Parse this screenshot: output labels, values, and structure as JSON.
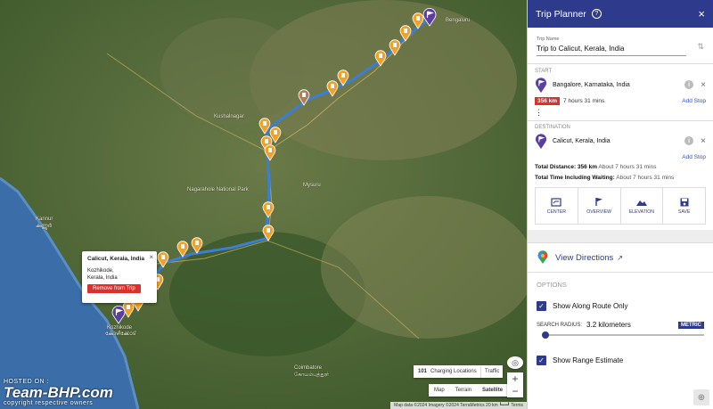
{
  "map": {
    "labels": [
      {
        "text": "Kozhikode"
      },
      {
        "text": "കോഴിക്കോട്"
      },
      {
        "text": "Coimbatore"
      },
      {
        "text": "கோயம்புத்தூர்"
      },
      {
        "text": "Kannur"
      },
      {
        "text": "കണ്ണൂർ"
      },
      {
        "text": "Kushalnagar"
      },
      {
        "text": "Nagarahole National Park"
      },
      {
        "text": "Mysuru"
      },
      {
        "text": "Bengaluru"
      }
    ],
    "popup": {
      "title": "Calicut, Kerala, India",
      "address_line1": "Kozhikode,",
      "address_line2": "Kerala, India",
      "remove_label": "Remove from Trip",
      "close_glyph": "×"
    },
    "charging": {
      "count": "101",
      "label": "Charging Locations"
    },
    "traffic_label": "Traffic",
    "map_types": [
      "Map",
      "Terrain",
      "Satellite"
    ],
    "active_map_type": "Satellite",
    "zoom_in": "+",
    "zoom_out": "−",
    "attribution": "Map data ©2024 Imagery ©2024 TerraMetrics   20 km ┗━━┛  Terms",
    "watermark": {
      "line1": "HOSTED ON :",
      "line2": "Team-BHP.com",
      "line3": "copyright respective owners"
    }
  },
  "panel": {
    "title": "Trip Planner",
    "close_glyph": "×",
    "trip_name_label": "Trip Name",
    "trip_name": "Trip to Calicut, Kerala, India",
    "start_label": "START",
    "start": "Bangalore, Karnataka, India",
    "leg_distance": "356 km",
    "leg_time": "7 hours 31 mins",
    "add_stop": "Add Stop",
    "destination_label": "DESTINATION",
    "destination": "Calicut, Kerala, India",
    "total_distance_label": "Total Distance:",
    "total_distance": "356 km",
    "total_distance_time": "About 7 hours 31 mins",
    "total_time_label": "Total Time Including Waiting:",
    "total_time": "About 7 hours 31 mins",
    "actions": [
      "CENTER",
      "OVERVIEW",
      "ELEVATION",
      "SAVE"
    ],
    "view_directions": "View Directions",
    "options_label": "OPTIONS",
    "show_along_route": "Show Along Route Only",
    "search_radius_label": "SEARCH RADIUS:",
    "search_radius": "3.2 kilometers",
    "metric_label": "METRIC",
    "show_range": "Show Range Estimate"
  },
  "colors": {
    "header": "#2e3a8c",
    "route": "#3b7fd4",
    "charger_pin": "#f5a022",
    "badge": "#d9312b"
  }
}
